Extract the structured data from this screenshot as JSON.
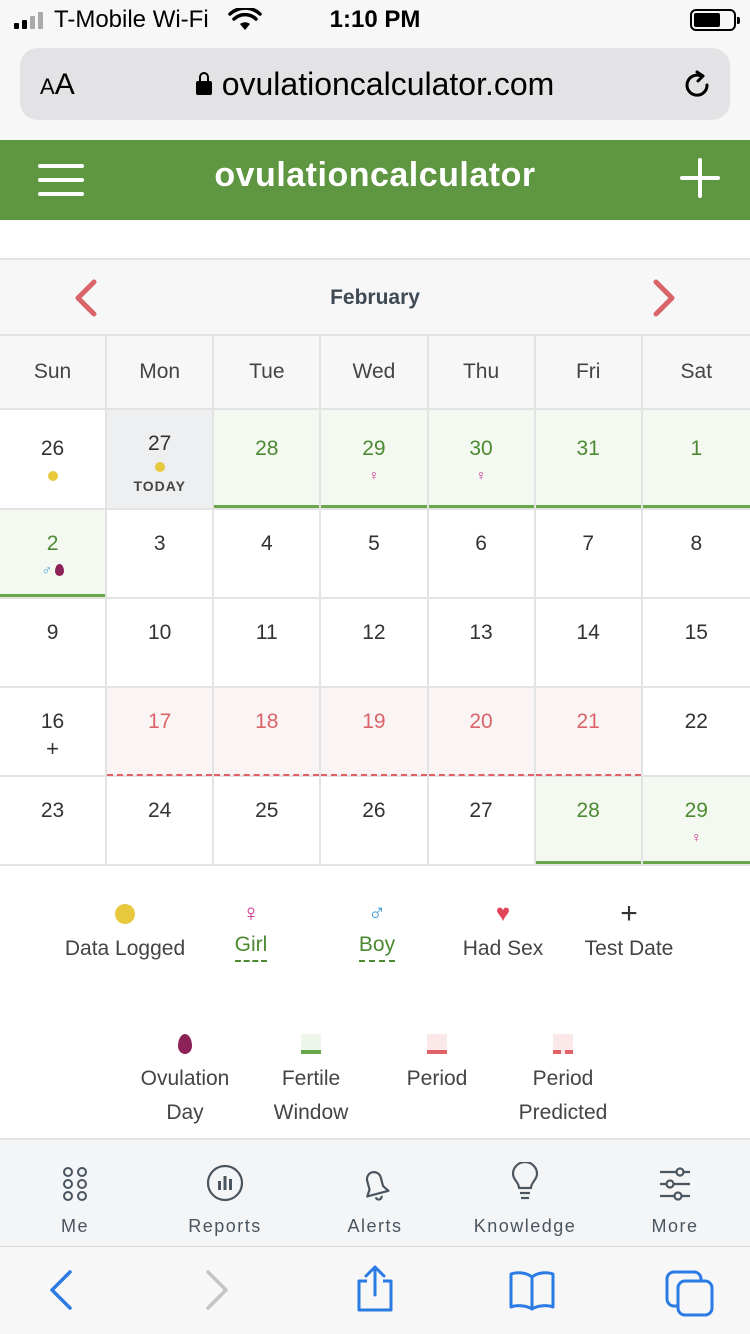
{
  "status": {
    "carrier": "T-Mobile Wi-Fi",
    "time": "1:10 PM"
  },
  "browser": {
    "text_size_label": "AA",
    "url": "ovulationcalculator.com"
  },
  "header": {
    "title": "ovulationcalculator"
  },
  "calendar": {
    "month": "February",
    "weekdays": [
      "Sun",
      "Mon",
      "Tue",
      "Wed",
      "Thu",
      "Fri",
      "Sat"
    ],
    "today_label": "TODAY",
    "weeks": [
      [
        "26",
        "27",
        "28",
        "29",
        "30",
        "31",
        "1"
      ],
      [
        "2",
        "3",
        "4",
        "5",
        "6",
        "7",
        "8"
      ],
      [
        "9",
        "10",
        "11",
        "12",
        "13",
        "14",
        "15"
      ],
      [
        "16",
        "17",
        "18",
        "19",
        "20",
        "21",
        "22"
      ],
      [
        "23",
        "24",
        "25",
        "26",
        "27",
        "28",
        "29"
      ]
    ],
    "symbols": {
      "girl": "♀",
      "boy": "♂",
      "test": "+"
    }
  },
  "legend": {
    "data_logged": "Data Logged",
    "girl": "Girl",
    "boy": "Boy",
    "had_sex": "Had Sex",
    "test_date": "Test Date",
    "ovulation_day": "Ovulation Day",
    "fertile_window": "Fertile Window",
    "period": "Period",
    "period_predicted": "Period Predicted",
    "girl_symbol": "♀",
    "boy_symbol": "♂",
    "heart_symbol": "♥",
    "plus_symbol": "+"
  },
  "tabs": [
    "Me",
    "Reports",
    "Alerts",
    "Knowledge",
    "More"
  ],
  "colors": {
    "brand_green": "#5f9642",
    "fertile_green": "#4c8a32",
    "period_red": "#d9656a",
    "nav_arrow": "#d9656a",
    "ios_blue": "#2a7be4"
  }
}
